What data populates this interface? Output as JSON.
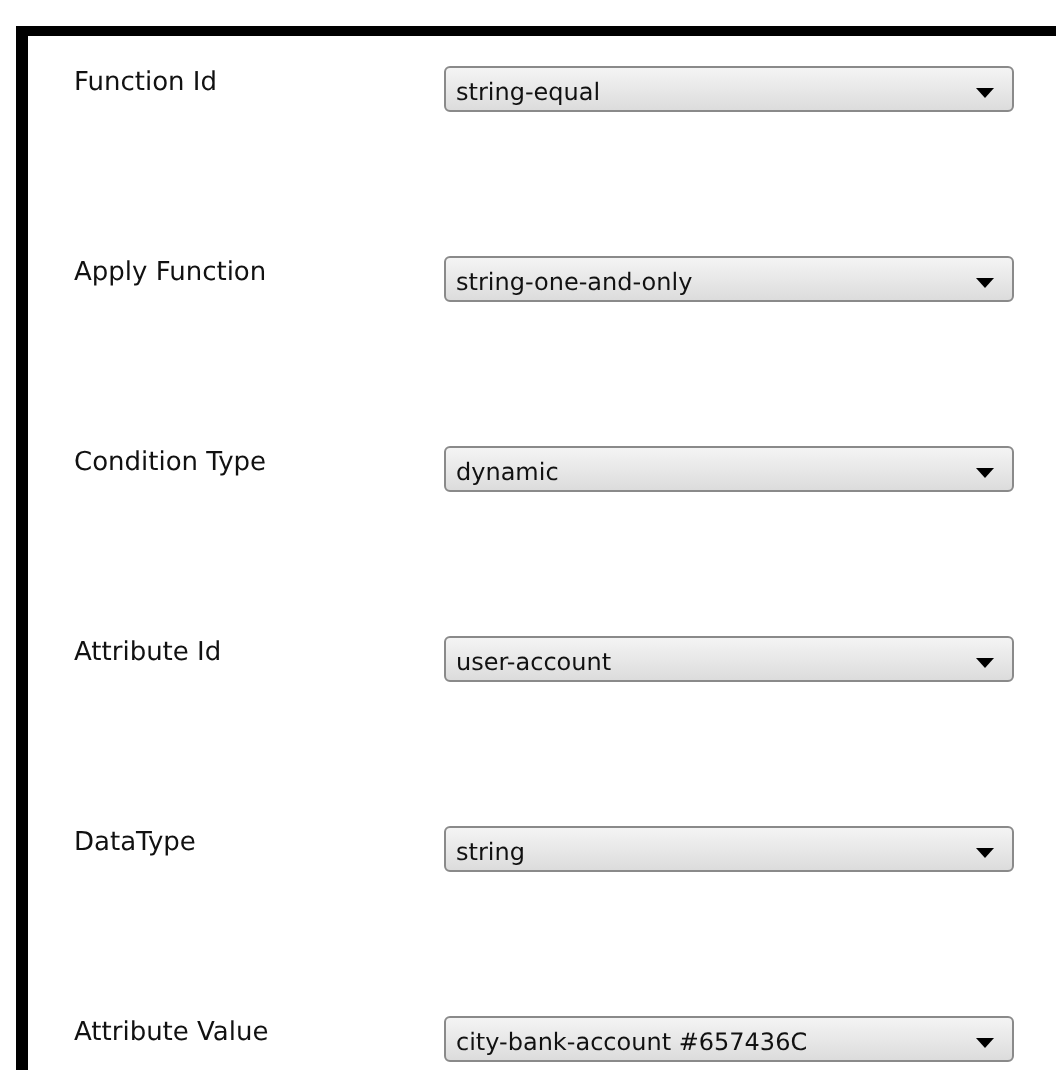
{
  "fields": [
    {
      "label": "Function Id",
      "value": "string-equal"
    },
    {
      "label": "Apply Function",
      "value": "string-one-and-only"
    },
    {
      "label": "Condition Type",
      "value": "dynamic"
    },
    {
      "label": "Attribute Id",
      "value": "user-account"
    },
    {
      "label": "DataType",
      "value": "string"
    },
    {
      "label": "Attribute Value",
      "value": "city-bank-account #657436C"
    }
  ]
}
